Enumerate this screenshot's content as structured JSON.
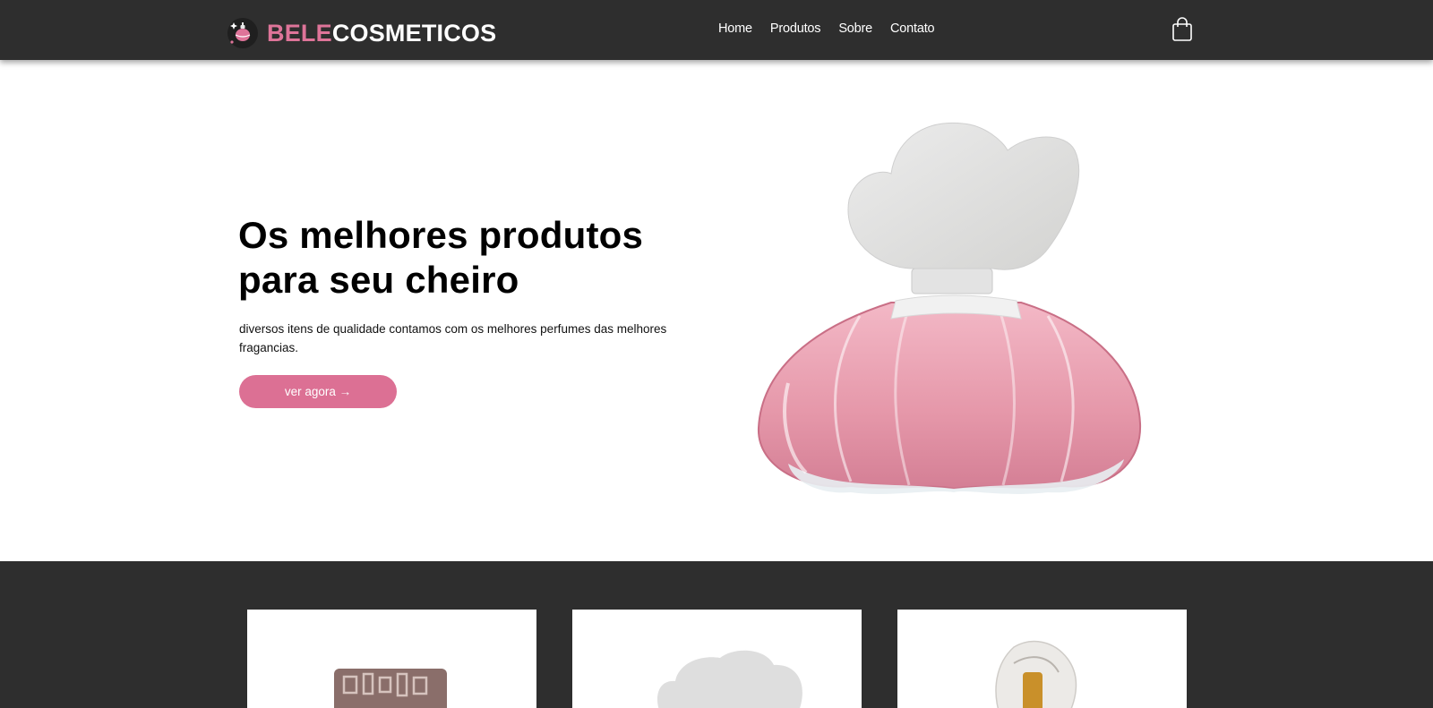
{
  "header": {
    "brand_part1": "BELE",
    "brand_part2": "COSMETICOS",
    "nav": [
      "Home",
      "Produtos",
      "Sobre",
      "Contato"
    ]
  },
  "hero": {
    "title_line1": "Os melhores produtos",
    "title_line2": "para seu cheiro",
    "description": "diversos itens de qualidade contamos com os melhores perfumes das melhores fragancias.",
    "cta_label": "ver agora →"
  },
  "colors": {
    "accent": "#dc7094",
    "dark": "#2e2e2e"
  },
  "icons": {
    "logo": "perfume-logo-icon",
    "cart": "shopping-bag-icon"
  }
}
